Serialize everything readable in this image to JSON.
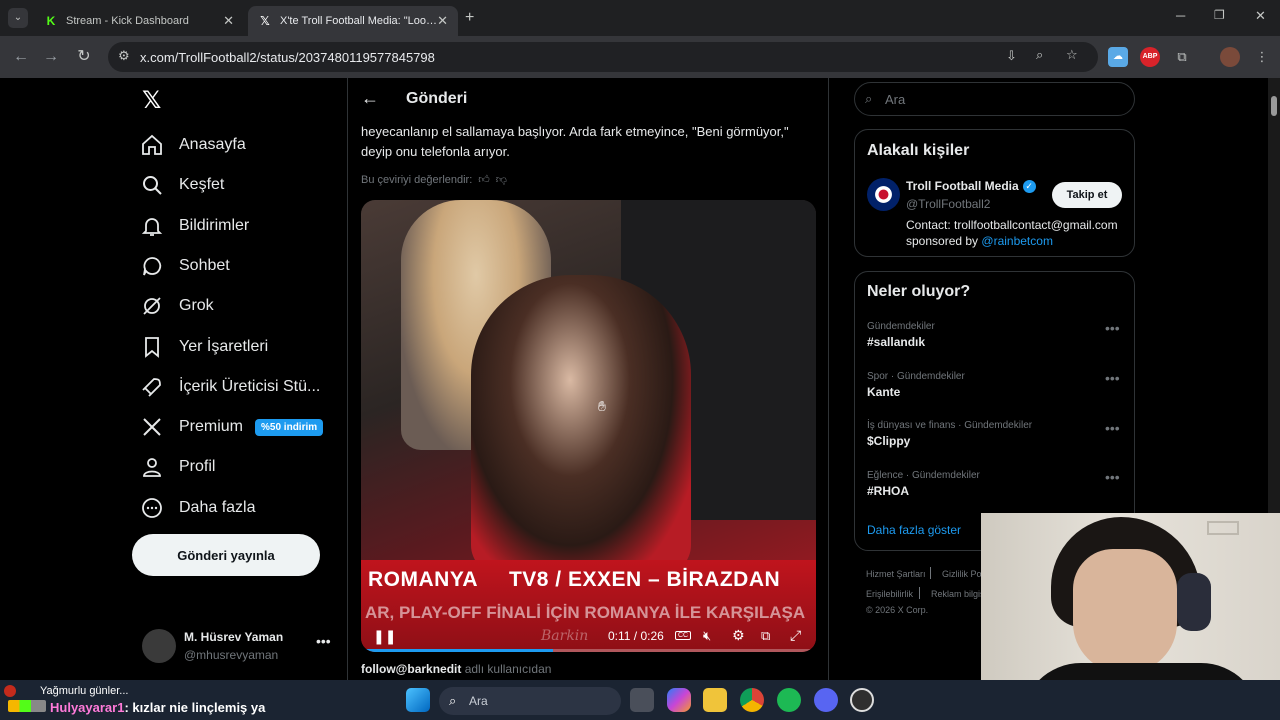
{
  "browser": {
    "tabs": [
      {
        "title": "Stream - Kick Dashboard",
        "active": false
      },
      {
        "title": "X'te Troll Football Media: \"Look at",
        "active": true
      }
    ],
    "url": "x.com/TrollFootball2/status/2037480119577845798",
    "ext_abp": "ABP"
  },
  "sidebar": {
    "nav": [
      {
        "label": "Anasayfa",
        "icon": "home-icon"
      },
      {
        "label": "Keşfet",
        "icon": "search-icon"
      },
      {
        "label": "Bildirimler",
        "icon": "bell-icon"
      },
      {
        "label": "Sohbet",
        "icon": "chat-icon"
      },
      {
        "label": "Grok",
        "icon": "grok-icon"
      },
      {
        "label": "Yer İşaretleri",
        "icon": "bookmark-icon"
      },
      {
        "label": "İçerik Üreticisi Stü...",
        "icon": "rocket-icon"
      },
      {
        "label": "Premium",
        "icon": "x-logo-icon"
      },
      {
        "label": "Profil",
        "icon": "person-icon"
      },
      {
        "label": "Daha fazla",
        "icon": "more-circle-icon"
      }
    ],
    "premium_badge": "%50 indirim",
    "post_button": "Gönderi yayınla",
    "account": {
      "name": "M. Hüsrev Yaman",
      "handle": "@mhusrevyaman"
    }
  },
  "main": {
    "header_title": "Gönderi",
    "tweet_text": "heyecanlanıp el sallamaya başlıyor. Arda fark etmeyince, \"Beni görmüyor,\" deyip onu telefonla arıyor.",
    "rate_translation": "Bu çeviriyi değerlendir:",
    "video": {
      "banner_line1": "ROMANYA     TV8 / EXXEN – BİRAZDAN",
      "banner_line2": "AR, PLAY-OFF FİNALİ İÇİN ROMANYA İLE KARŞILAŞA",
      "watermark": "Barkin",
      "time": "0:11 / 0:26",
      "cc": "CC",
      "progress": 0.423
    },
    "credit_user": "follow@barknedit",
    "credit_suffix": " adlı kullanıcıdan"
  },
  "right": {
    "search_placeholder": "Ara",
    "related_title": "Alakalı kişiler",
    "related_person": {
      "name": "Troll Football Media",
      "handle": "@TrollFootball2",
      "bio_line1": "Contact: trollfootballcontact@gmail.com",
      "bio_prefix": "sponsored by ",
      "bio_link": "@rainbetcom",
      "follow_label": "Takip et"
    },
    "trends_title": "Neler oluyor?",
    "trends": [
      {
        "meta": "Gündemdekiler",
        "name": "#sallandık"
      },
      {
        "meta": "Spor · Gündemdekiler",
        "name": "Kante"
      },
      {
        "meta": "İş dünyası ve finans · Gündemdekiler",
        "name": "$Clippy"
      },
      {
        "meta": "Eğlence · Gündemdekiler",
        "name": "#RHOA"
      }
    ],
    "show_more": "Daha fazla göster",
    "footer": [
      "Hizmet Şartları",
      "Gizlilik Po",
      "Erişilebilirlik",
      "Reklam bilgisi",
      "© 2026 X Corp."
    ]
  },
  "overlay": {
    "chat_top": "Yağmurlu günler...",
    "chat_user": "Hulyayarar1",
    "chat_msg": ": kızlar nie linçlemiş ya"
  },
  "taskbar": {
    "search_placeholder": "Ara"
  }
}
